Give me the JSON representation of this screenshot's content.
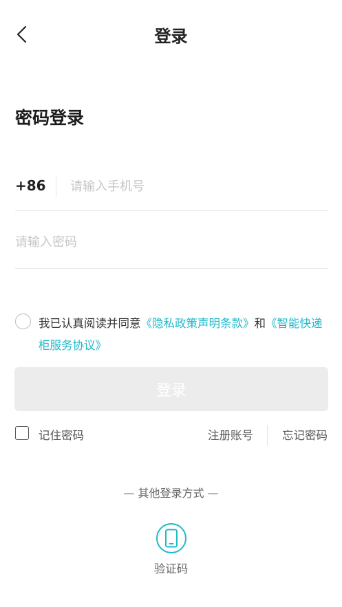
{
  "header": {
    "title": "登录"
  },
  "section_title": "密码登录",
  "phone": {
    "country_code": "+86",
    "placeholder": "请输入手机号",
    "value": ""
  },
  "password": {
    "placeholder": "请输入密码",
    "value": ""
  },
  "agreement": {
    "prefix": "我已认真阅读并同意",
    "privacy_link": "《隐私政策声明条款》",
    "conjunction": "和",
    "service_link": "《智能快递柜服务协议》",
    "checked": false
  },
  "login_button": "登录",
  "remember": {
    "label": "记住密码",
    "checked": false
  },
  "register_link": "注册账号",
  "forgot_link": "忘记密码",
  "other_methods": {
    "title": "— 其他登录方式 —",
    "sms_label": "验证码",
    "sms_icon": "phone-icon"
  },
  "colors": {
    "accent": "#1fb9c9",
    "button_disabled": "#ececec",
    "divider": "#e9e9e9",
    "placeholder": "#c6c6c6"
  }
}
